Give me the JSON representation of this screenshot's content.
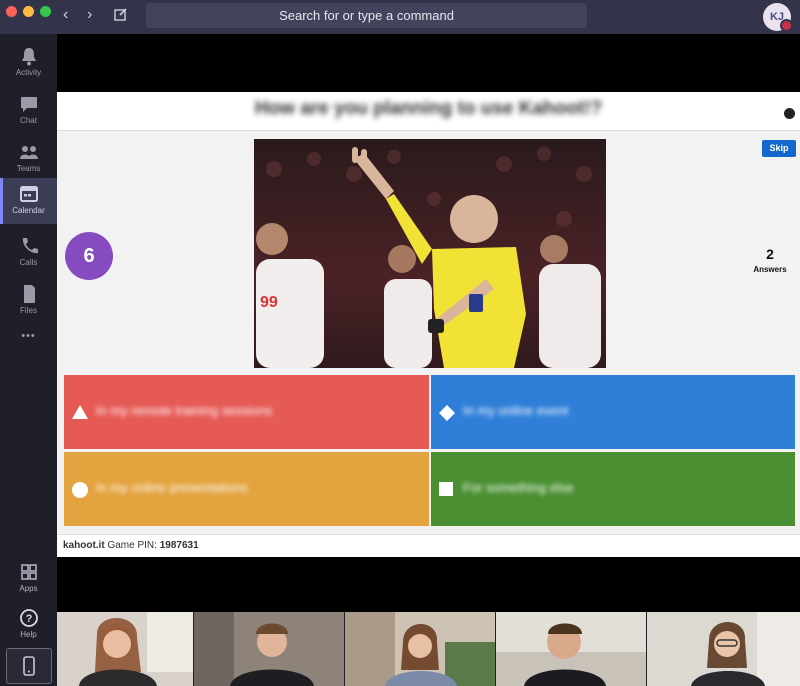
{
  "titlebar": {
    "search_placeholder": "Search for or type a command",
    "avatar_initials": "KJ",
    "back_glyph": "‹",
    "forward_glyph": "›",
    "compose_icon": "compose-icon",
    "traffic_lights": [
      "#fc605c",
      "#fdbc40",
      "#34c84a"
    ]
  },
  "sidebar": {
    "items": [
      {
        "label": "Activity",
        "icon": "bell-icon"
      },
      {
        "label": "Chat",
        "icon": "chat-icon"
      },
      {
        "label": "Teams",
        "icon": "teams-icon"
      },
      {
        "label": "Calendar",
        "icon": "calendar-icon",
        "active": true
      },
      {
        "label": "Calls",
        "icon": "phone-icon"
      },
      {
        "label": "Files",
        "icon": "file-icon"
      }
    ],
    "more_label": "•••",
    "bottom": [
      {
        "label": "Apps",
        "icon": "apps-icon"
      },
      {
        "label": "Help",
        "icon": "help-icon"
      }
    ]
  },
  "kahoot": {
    "question": "How are you planning to use Kahoot!?",
    "skip_label": "Skip",
    "timer": "6",
    "answers_count": "2",
    "answers_label": "Answers",
    "answers": [
      {
        "text": "In my remote training sessions",
        "color": "#e65a55",
        "shape": "triangle"
      },
      {
        "text": "In my online event",
        "color": "#2f7fd8",
        "shape": "diamond"
      },
      {
        "text": "In my online presentations",
        "color": "#e3a33e",
        "shape": "circle"
      },
      {
        "text": "For something else",
        "color": "#4a8f32",
        "shape": "square"
      }
    ],
    "footer_site": "kahoot.it",
    "footer_pin_label": "Game PIN:",
    "footer_pin": "1987631"
  },
  "colors": {
    "titlebar": "#33344a",
    "rail": "#1f1f2a",
    "timer": "#864cbf",
    "skip": "#1368ce"
  }
}
